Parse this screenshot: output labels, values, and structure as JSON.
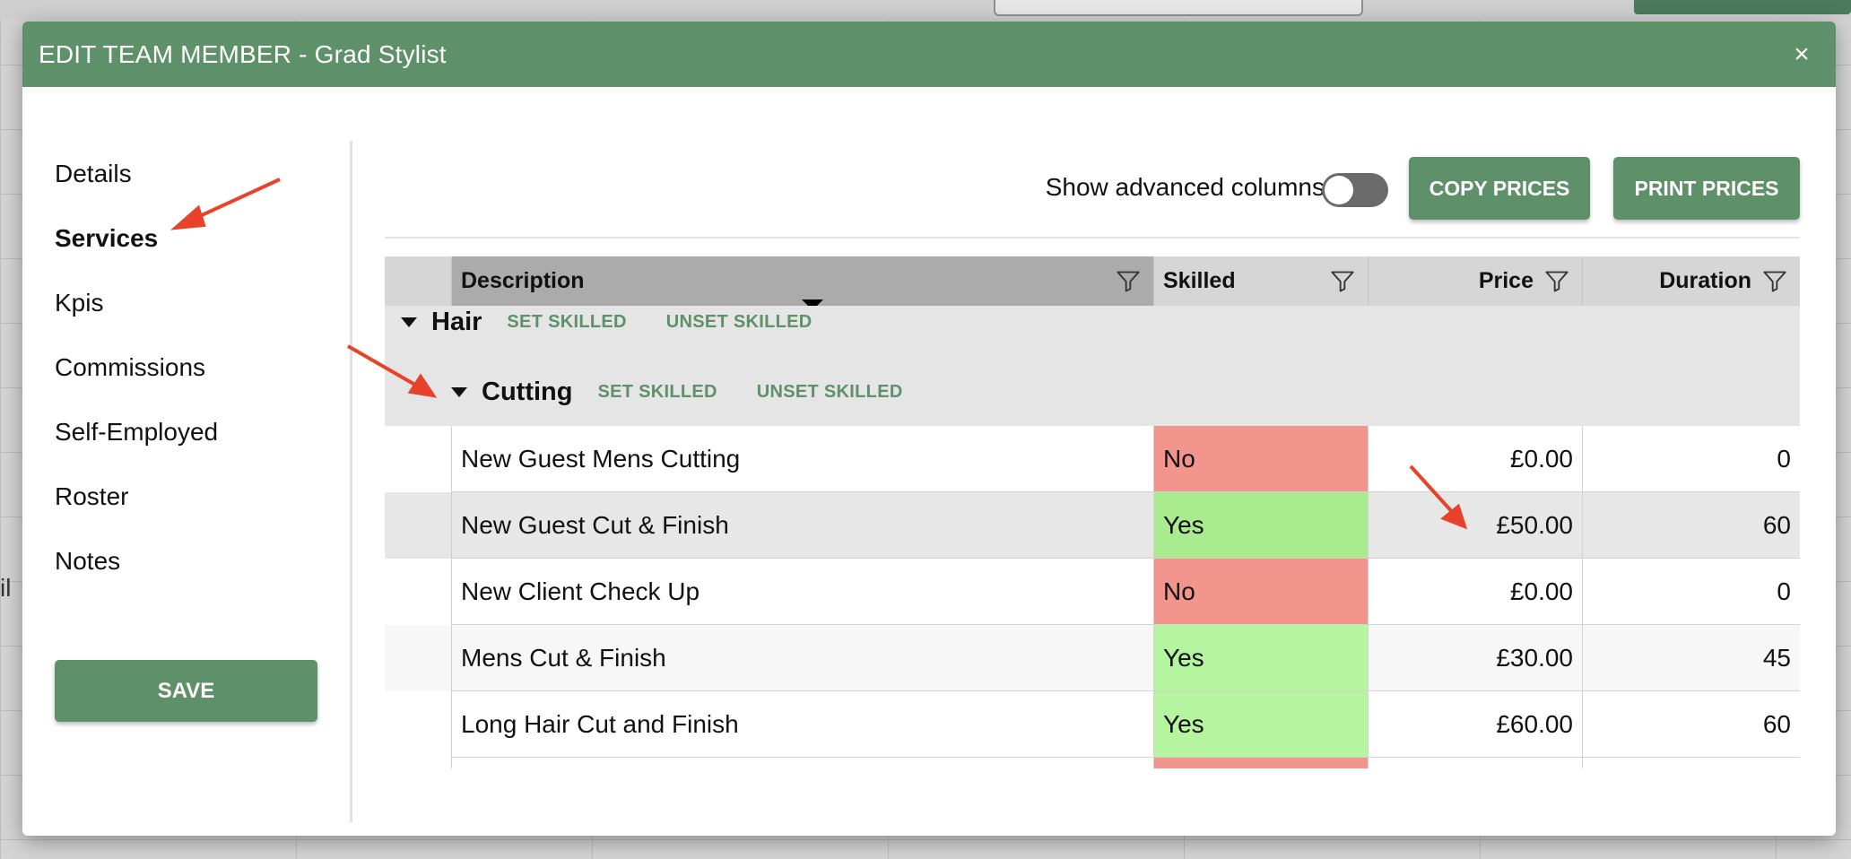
{
  "background": {
    "fragment_text": "il"
  },
  "modal": {
    "title": "EDIT TEAM MEMBER - Grad Stylist",
    "close_glyph": "×"
  },
  "sidebar": {
    "items": [
      {
        "label": "Details",
        "active": false
      },
      {
        "label": "Services",
        "active": true
      },
      {
        "label": "Kpis",
        "active": false
      },
      {
        "label": "Commissions",
        "active": false
      },
      {
        "label": "Self-Employed",
        "active": false
      },
      {
        "label": "Roster",
        "active": false
      },
      {
        "label": "Notes",
        "active": false
      }
    ],
    "save_label": "SAVE"
  },
  "toolbar": {
    "advanced_label": "Show advanced columns",
    "advanced_on": false,
    "copy_label": "COPY PRICES",
    "print_label": "PRINT PRICES"
  },
  "grid": {
    "columns": {
      "description": "Description",
      "skilled": "Skilled",
      "price": "Price",
      "duration": "Duration"
    },
    "group": {
      "name": "Hair",
      "set_label": "SET SKILLED",
      "unset_label": "UNSET SKILLED"
    },
    "subgroup": {
      "name": "Cutting",
      "set_label": "SET SKILLED",
      "unset_label": "UNSET SKILLED"
    },
    "rows": [
      {
        "description": "New Guest Mens Cutting",
        "skilled": "No",
        "price": "£0.00",
        "duration": "0"
      },
      {
        "description": "New Guest Cut & Finish",
        "skilled": "Yes",
        "price": "£50.00",
        "duration": "60"
      },
      {
        "description": "New Client Check Up",
        "skilled": "No",
        "price": "£0.00",
        "duration": "0"
      },
      {
        "description": "Mens Cut & Finish",
        "skilled": "Yes",
        "price": "£30.00",
        "duration": "45"
      },
      {
        "description": "Long Hair Cut and Finish",
        "skilled": "Yes",
        "price": "£60.00",
        "duration": "60"
      }
    ]
  },
  "colors": {
    "accent": "#5e9069",
    "skilled_no": "#f2968d",
    "skilled_yes": "#b5f5a0",
    "annotation_arrow": "#e8432a"
  },
  "icons": {
    "filter": "filter-icon",
    "close": "close-icon",
    "caret": "caret-down-icon"
  }
}
